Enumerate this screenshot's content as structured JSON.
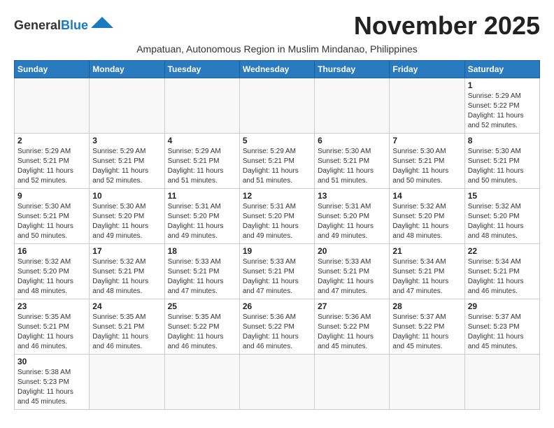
{
  "header": {
    "logo_general": "General",
    "logo_blue": "Blue",
    "month_title": "November 2025",
    "subtitle": "Ampatuan, Autonomous Region in Muslim Mindanao, Philippines"
  },
  "weekdays": [
    "Sunday",
    "Monday",
    "Tuesday",
    "Wednesday",
    "Thursday",
    "Friday",
    "Saturday"
  ],
  "days": [
    {
      "num": "",
      "sunrise": "",
      "sunset": "",
      "daylight": ""
    },
    {
      "num": "",
      "sunrise": "",
      "sunset": "",
      "daylight": ""
    },
    {
      "num": "",
      "sunrise": "",
      "sunset": "",
      "daylight": ""
    },
    {
      "num": "",
      "sunrise": "",
      "sunset": "",
      "daylight": ""
    },
    {
      "num": "",
      "sunrise": "",
      "sunset": "",
      "daylight": ""
    },
    {
      "num": "",
      "sunrise": "",
      "sunset": "",
      "daylight": ""
    },
    {
      "num": "1",
      "sunrise": "5:29 AM",
      "sunset": "5:22 PM",
      "daylight": "11 hours and 52 minutes."
    },
    {
      "num": "2",
      "sunrise": "5:29 AM",
      "sunset": "5:21 PM",
      "daylight": "11 hours and 52 minutes."
    },
    {
      "num": "3",
      "sunrise": "5:29 AM",
      "sunset": "5:21 PM",
      "daylight": "11 hours and 52 minutes."
    },
    {
      "num": "4",
      "sunrise": "5:29 AM",
      "sunset": "5:21 PM",
      "daylight": "11 hours and 51 minutes."
    },
    {
      "num": "5",
      "sunrise": "5:29 AM",
      "sunset": "5:21 PM",
      "daylight": "11 hours and 51 minutes."
    },
    {
      "num": "6",
      "sunrise": "5:30 AM",
      "sunset": "5:21 PM",
      "daylight": "11 hours and 51 minutes."
    },
    {
      "num": "7",
      "sunrise": "5:30 AM",
      "sunset": "5:21 PM",
      "daylight": "11 hours and 50 minutes."
    },
    {
      "num": "8",
      "sunrise": "5:30 AM",
      "sunset": "5:21 PM",
      "daylight": "11 hours and 50 minutes."
    },
    {
      "num": "9",
      "sunrise": "5:30 AM",
      "sunset": "5:21 PM",
      "daylight": "11 hours and 50 minutes."
    },
    {
      "num": "10",
      "sunrise": "5:30 AM",
      "sunset": "5:20 PM",
      "daylight": "11 hours and 49 minutes."
    },
    {
      "num": "11",
      "sunrise": "5:31 AM",
      "sunset": "5:20 PM",
      "daylight": "11 hours and 49 minutes."
    },
    {
      "num": "12",
      "sunrise": "5:31 AM",
      "sunset": "5:20 PM",
      "daylight": "11 hours and 49 minutes."
    },
    {
      "num": "13",
      "sunrise": "5:31 AM",
      "sunset": "5:20 PM",
      "daylight": "11 hours and 49 minutes."
    },
    {
      "num": "14",
      "sunrise": "5:32 AM",
      "sunset": "5:20 PM",
      "daylight": "11 hours and 48 minutes."
    },
    {
      "num": "15",
      "sunrise": "5:32 AM",
      "sunset": "5:20 PM",
      "daylight": "11 hours and 48 minutes."
    },
    {
      "num": "16",
      "sunrise": "5:32 AM",
      "sunset": "5:20 PM",
      "daylight": "11 hours and 48 minutes."
    },
    {
      "num": "17",
      "sunrise": "5:32 AM",
      "sunset": "5:21 PM",
      "daylight": "11 hours and 48 minutes."
    },
    {
      "num": "18",
      "sunrise": "5:33 AM",
      "sunset": "5:21 PM",
      "daylight": "11 hours and 47 minutes."
    },
    {
      "num": "19",
      "sunrise": "5:33 AM",
      "sunset": "5:21 PM",
      "daylight": "11 hours and 47 minutes."
    },
    {
      "num": "20",
      "sunrise": "5:33 AM",
      "sunset": "5:21 PM",
      "daylight": "11 hours and 47 minutes."
    },
    {
      "num": "21",
      "sunrise": "5:34 AM",
      "sunset": "5:21 PM",
      "daylight": "11 hours and 47 minutes."
    },
    {
      "num": "22",
      "sunrise": "5:34 AM",
      "sunset": "5:21 PM",
      "daylight": "11 hours and 46 minutes."
    },
    {
      "num": "23",
      "sunrise": "5:35 AM",
      "sunset": "5:21 PM",
      "daylight": "11 hours and 46 minutes."
    },
    {
      "num": "24",
      "sunrise": "5:35 AM",
      "sunset": "5:21 PM",
      "daylight": "11 hours and 46 minutes."
    },
    {
      "num": "25",
      "sunrise": "5:35 AM",
      "sunset": "5:22 PM",
      "daylight": "11 hours and 46 minutes."
    },
    {
      "num": "26",
      "sunrise": "5:36 AM",
      "sunset": "5:22 PM",
      "daylight": "11 hours and 46 minutes."
    },
    {
      "num": "27",
      "sunrise": "5:36 AM",
      "sunset": "5:22 PM",
      "daylight": "11 hours and 45 minutes."
    },
    {
      "num": "28",
      "sunrise": "5:37 AM",
      "sunset": "5:22 PM",
      "daylight": "11 hours and 45 minutes."
    },
    {
      "num": "29",
      "sunrise": "5:37 AM",
      "sunset": "5:23 PM",
      "daylight": "11 hours and 45 minutes."
    },
    {
      "num": "30",
      "sunrise": "5:38 AM",
      "sunset": "5:23 PM",
      "daylight": "11 hours and 45 minutes."
    }
  ]
}
